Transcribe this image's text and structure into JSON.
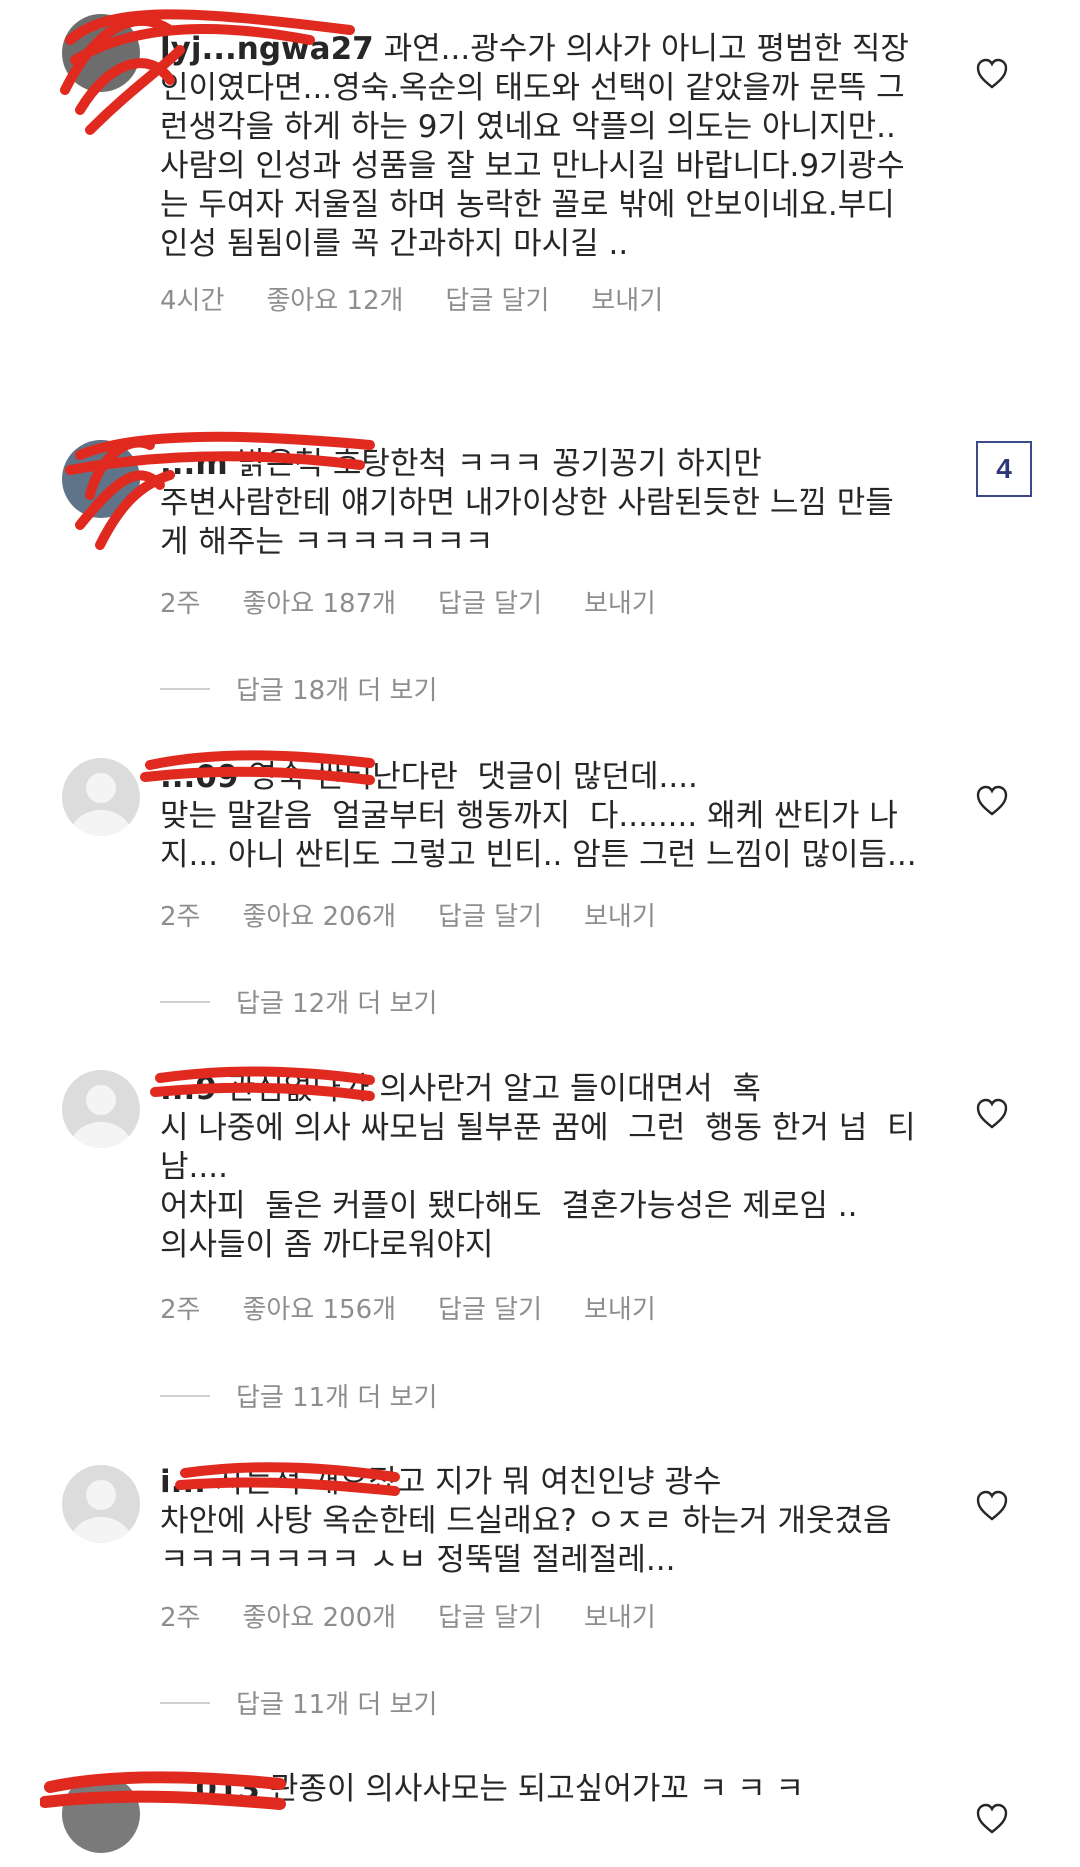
{
  "badge": "4",
  "comments": [
    {
      "username": "lyj...ngwa27",
      "text": " 과연...광수가 의사가 아니고 평범한 직장\n인이였다면...영숙.옥순의 태도와 선택이 같았을까 문뜩 그\n런생각을 하게 하는 9기 였네요 악플의 의도는 아니지만..\n사람의 인성과 성품을 잘 보고 만나시길 바랍니다.9기광수\n는 두여자 저울질 하며 농락한 꼴로 밖에 안보이네요.부디\n인성 됨됨이를 꼭 간과하지 마시길 ..",
      "time": "4시간",
      "likes": "좋아요 12개",
      "reply": "답글 달기",
      "send": "보내기"
    },
    {
      "username": "...m",
      "text": " 밝은척 호탕한척 ㅋㅋㅋ 꽁기꽁기 하지만\n주변사람한테 얘기하면 내가이상한 사람된듯한 느낌 만들\n게 해주는 ㅋㅋㅋㅋㅋㅋㅋ",
      "time": "2주",
      "likes": "좋아요 187개",
      "reply": "답글 달기",
      "send": "보내기",
      "more": "답글 18개 더 보기"
    },
    {
      "username": "...09",
      "text": " 영숙 싼티난다란  댓글이 많던데....\n맞는 말같음  얼굴부터 행동까지  다........ 왜케 싼티가 나\n지... 아니 싼티도 그렇고 빈티.. 암튼 그런 느낌이 많이듬...",
      "time": "2주",
      "likes": "좋아요 206개",
      "reply": "답글 달기",
      "send": "보내기",
      "more": "답글 12개 더 보기"
    },
    {
      "username": "...9",
      "text": " 관심없다가 의사란거 알고 들이대면서  혹\n시 나중에 의사 싸모님 될부푼 꿈에  그런  행동 한거 넘  티\n남....\n어차피  둘은 커플이 됐다해도  결혼가능성은 제로임 ..\n의사들이 좀 까다로워야지",
      "time": "2주",
      "likes": "좋아요 156개",
      "reply": "답글 달기",
      "send": "보내기",
      "more": "답글 11개 더 보기"
    },
    {
      "username": "i...",
      "text": " 자는척 개오졌고 지가 뭐 여친인냥 광수\n차안에 사탕 옥순한테 드실래요? ㅇㅈㄹ 하는거 개웃겼음\nㅋㅋㅋㅋㅋㅋㅋ ㅅㅂ 정뚝떨 절레절레...",
      "time": "2주",
      "likes": "좋아요 200개",
      "reply": "답글 달기",
      "send": "보내기",
      "more": "답글 11개 더 보기"
    },
    {
      "username": "...013",
      "text": " 관종이 의사사모는 되고싶어가꼬 ㅋ ㅋ ㅋ"
    }
  ],
  "colors": {
    "text": "#262626",
    "meta": "#8e8e8e",
    "scribble": "#e02a1f",
    "badge_border": "#3a4a8a"
  },
  "icons": [
    "heart-icon",
    "default-avatar-icon"
  ]
}
